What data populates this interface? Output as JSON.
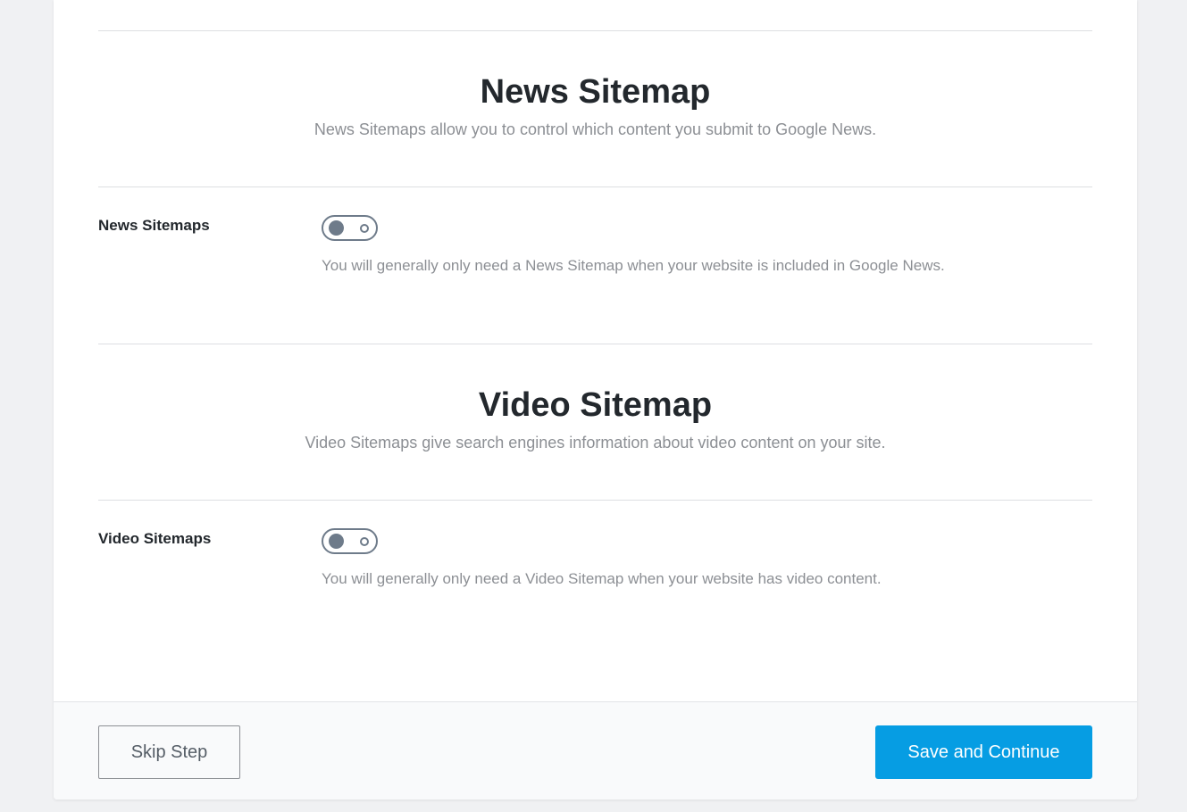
{
  "news": {
    "title": "News Sitemap",
    "description": "News Sitemaps allow you to control which content you submit to Google News.",
    "setting_label": "News Sitemaps",
    "toggle_enabled": false,
    "setting_help": "You will generally only need a News Sitemap when your website is included in Google News."
  },
  "video": {
    "title": "Video Sitemap",
    "description": "Video Sitemaps give search engines information about video content on your site.",
    "setting_label": "Video Sitemaps",
    "toggle_enabled": false,
    "setting_help": "You will generally only need a Video Sitemap when your website has video content."
  },
  "footer": {
    "skip_label": "Skip Step",
    "save_label": "Save and Continue"
  },
  "colors": {
    "primary_button": "#069de3",
    "toggle_off": "#6e7b8a",
    "muted_text": "#8c8f94",
    "page_background": "#f0f1f3"
  }
}
